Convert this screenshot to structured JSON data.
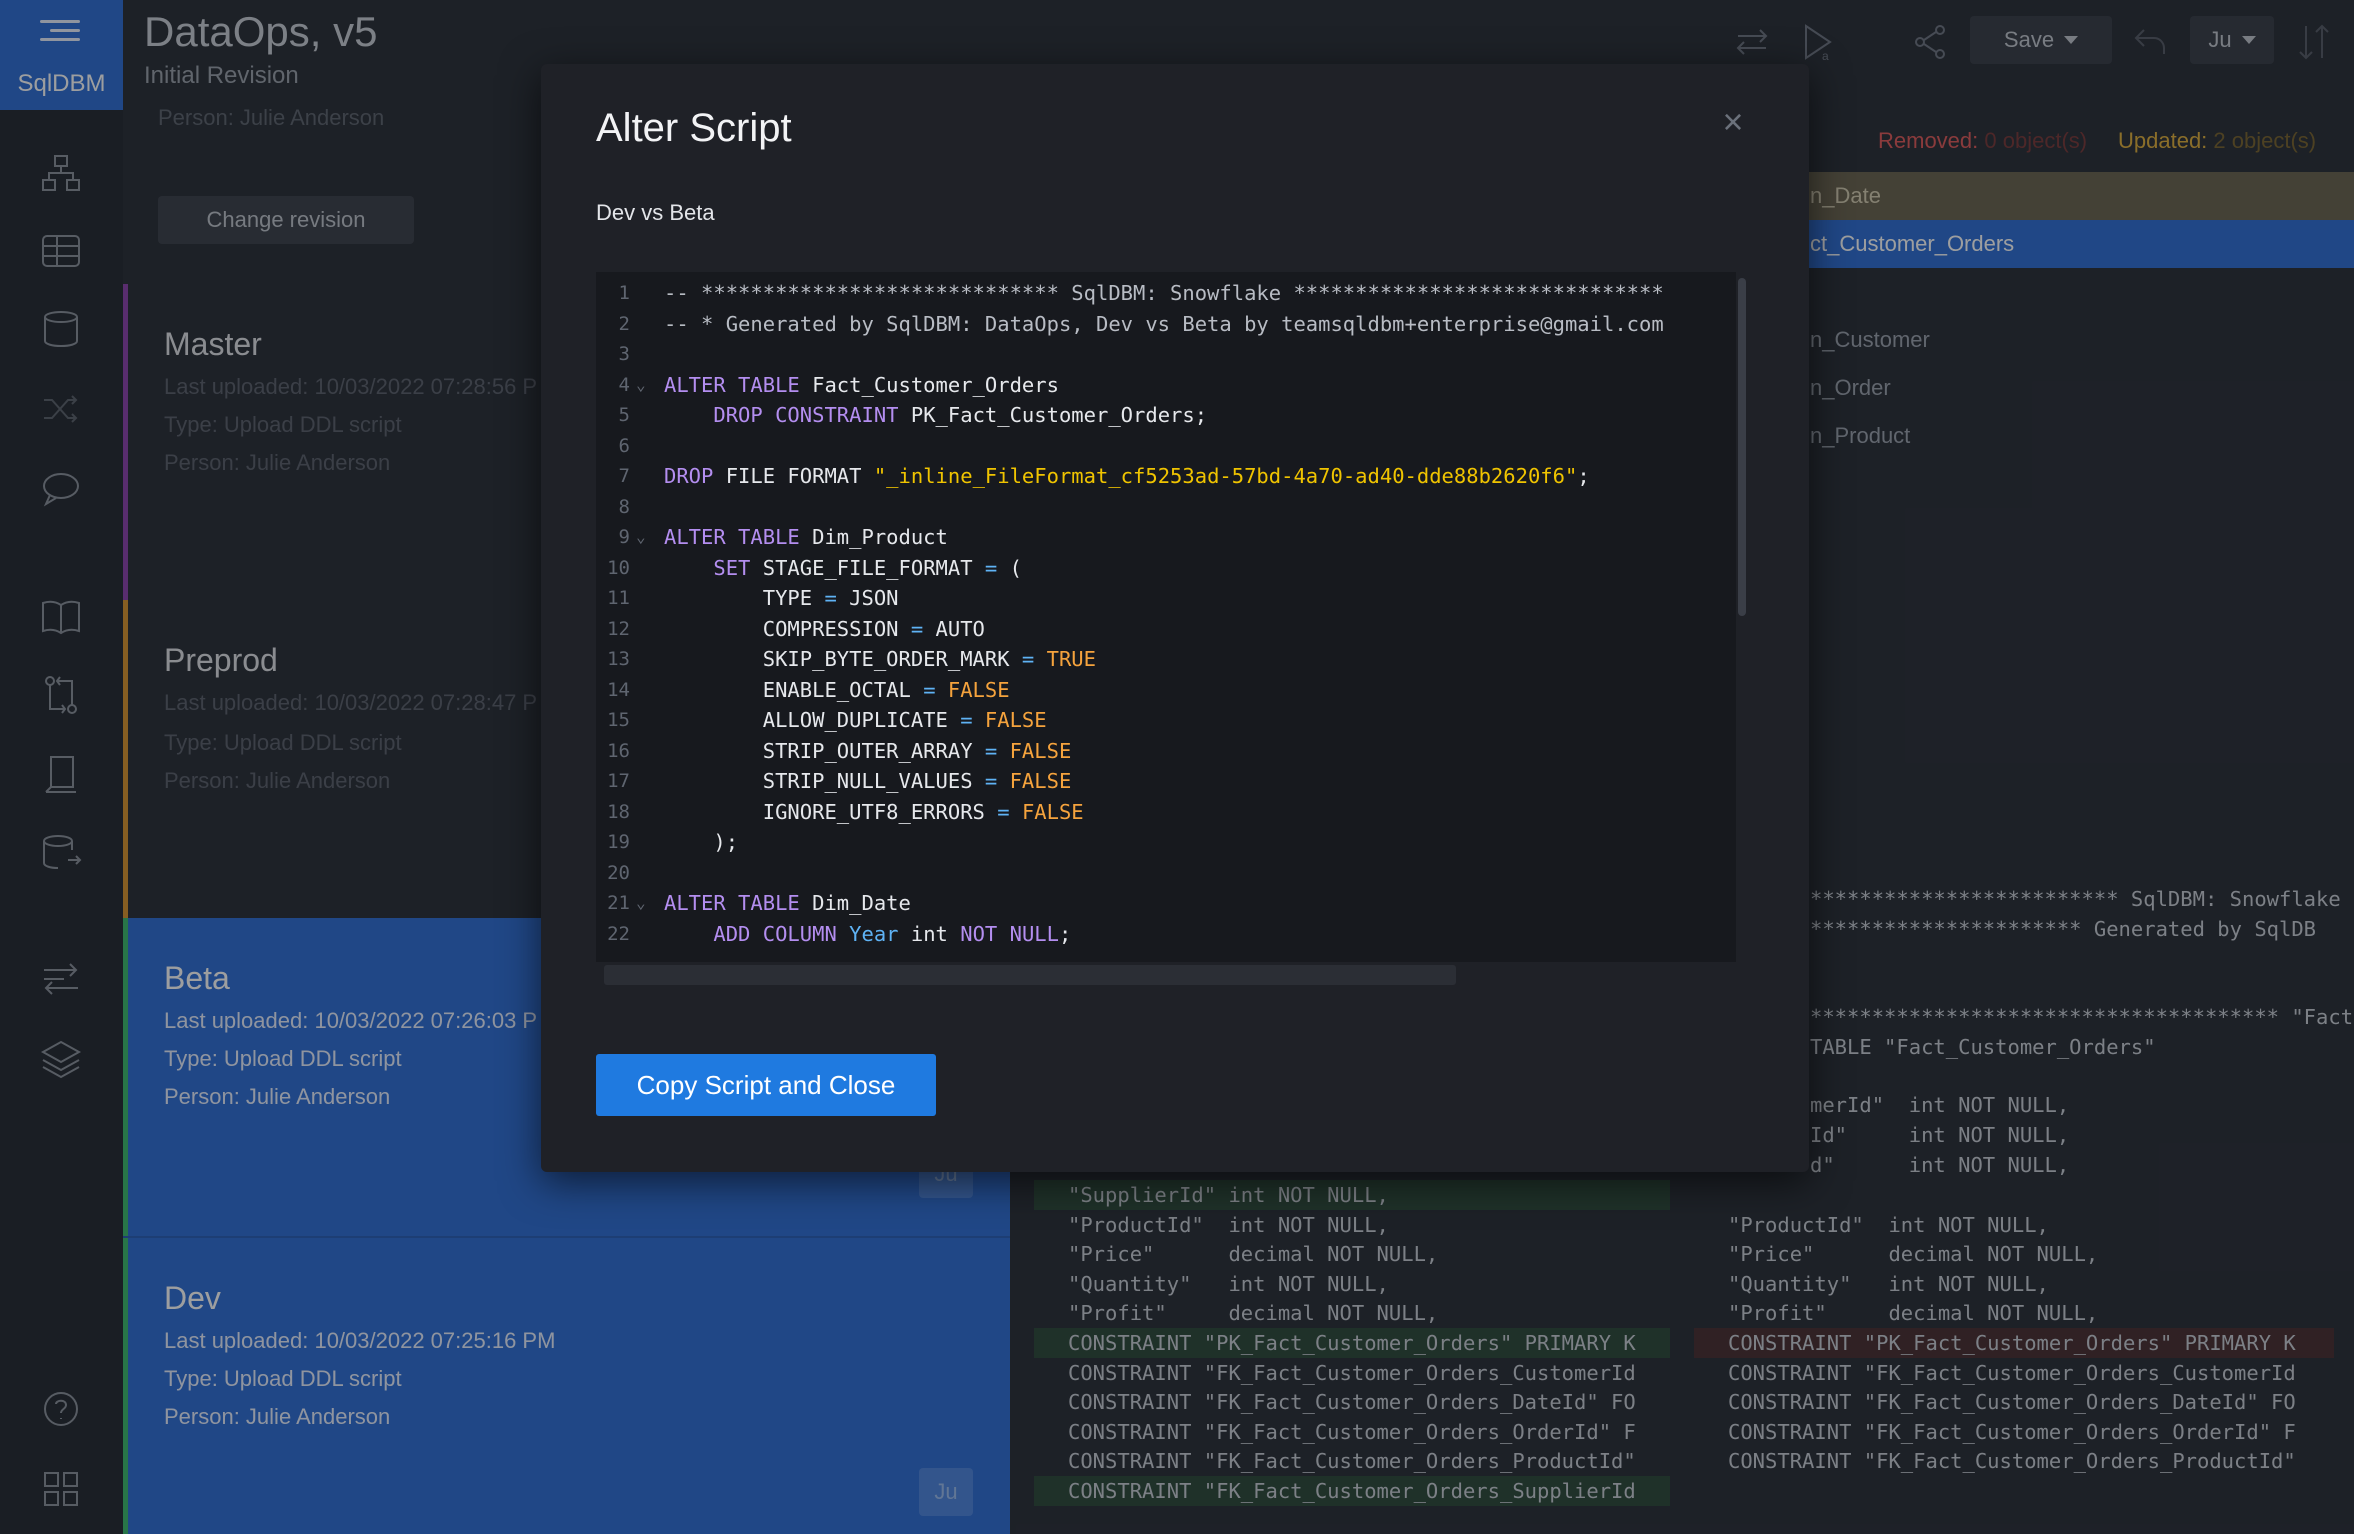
{
  "brand": {
    "name": "SqlDBM"
  },
  "header": {
    "title": "DataOps, v5",
    "subtitle": "Initial Revision",
    "save_label": "Save",
    "user_label": "Ju"
  },
  "revisions": {
    "top_person": "Person: Julie Anderson",
    "change_revision_label": "Change revision",
    "items": [
      {
        "name": "Master",
        "uploaded": "Last uploaded: 10/03/2022 07:28:56 P",
        "type": "Type: Upload DDL script",
        "person": "Person: Julie Anderson",
        "accent": "#9b59b6"
      },
      {
        "name": "Preprod",
        "uploaded": "Last uploaded: 10/03/2022 07:28:47 P",
        "type": "Type: Upload DDL script",
        "person": "Person: Julie Anderson",
        "accent": "#e6a23c"
      },
      {
        "name": "Beta",
        "uploaded": "Last uploaded: 10/03/2022 07:26:03 P",
        "type": "Type: Upload DDL script",
        "person": "Person: Julie Anderson",
        "accent": "#3dbb6e",
        "badge": "Ju"
      },
      {
        "name": "Dev",
        "uploaded": "Last uploaded: 10/03/2022 07:25:16 PM",
        "type": "Type: Upload DDL script",
        "person": "Person: Julie Anderson",
        "accent": "#3dbb6e",
        "badge": "Ju"
      }
    ]
  },
  "compare": {
    "removed_label": "Removed:",
    "removed_value": "0 object(s)",
    "updated_label": "Updated:",
    "updated_value": "2 object(s)",
    "objects": [
      "n_Date",
      "ct_Customer_Orders",
      "n_Customer",
      "n_Order",
      "n_Product"
    ],
    "right_code": [
      "************************* SqlDBM: Snowflake",
      "********************** Generated by SqlDB",
      "************************************** \"Fact",
      "TABLE \"Fact_Customer_Orders\"",
      "merId\"  int NOT NULL,",
      "Id\"     int NOT NULL,",
      "d\"      int NOT NULL,"
    ],
    "left_diff": [
      "\"SupplierId\" int NOT NULL,",
      "\"ProductId\"  int NOT NULL,",
      "\"Price\"      decimal NOT NULL,",
      "\"Quantity\"   int NOT NULL,",
      "\"Profit\"     decimal NOT NULL,",
      "CONSTRAINT \"PK_Fact_Customer_Orders\" PRIMARY K",
      "CONSTRAINT \"FK_Fact_Customer_Orders_CustomerId",
      "CONSTRAINT \"FK_Fact_Customer_Orders_DateId\" FO",
      "CONSTRAINT \"FK_Fact_Customer_Orders_OrderId\" F",
      "CONSTRAINT \"FK_Fact_Customer_Orders_ProductId\"",
      "CONSTRAINT \"FK_Fact_Customer_Orders_SupplierId"
    ],
    "right_diff": [
      "",
      "\"ProductId\"  int NOT NULL,",
      "\"Price\"      decimal NOT NULL,",
      "\"Quantity\"   int NOT NULL,",
      "\"Profit\"     decimal NOT NULL,",
      "CONSTRAINT \"PK_Fact_Customer_Orders\" PRIMARY K",
      "CONSTRAINT \"FK_Fact_Customer_Orders_CustomerId",
      "CONSTRAINT \"FK_Fact_Customer_Orders_DateId\" FO",
      "CONSTRAINT \"FK_Fact_Customer_Orders_OrderId\" F",
      "CONSTRAINT \"FK_Fact_Customer_Orders_ProductId\"",
      ""
    ]
  },
  "modal": {
    "title": "Alter Script",
    "close_glyph": "×",
    "subtitle": "Dev vs Beta",
    "copy_button_label": "Copy Script and Close",
    "lines": [
      {
        "n": "1",
        "tokens": [
          {
            "t": "-- ***************************** SqlDBM: Snowflake ******************************",
            "c": "cm"
          }
        ]
      },
      {
        "n": "2",
        "tokens": [
          {
            "t": "-- * Generated by SqlDBM: DataOps, Dev vs Beta by teamsqldbm+enterprise@gmail.com",
            "c": "cm"
          }
        ]
      },
      {
        "n": "3",
        "tokens": []
      },
      {
        "n": "4",
        "fold": true,
        "tokens": [
          {
            "t": "ALTER TABLE",
            "c": "kw"
          },
          {
            "t": " Fact_Customer_Orders"
          }
        ]
      },
      {
        "n": "5",
        "tokens": [
          {
            "t": "    "
          },
          {
            "t": "DROP CONSTRAINT",
            "c": "kw"
          },
          {
            "t": " PK_Fact_Customer_Orders;"
          }
        ]
      },
      {
        "n": "6",
        "tokens": []
      },
      {
        "n": "7",
        "tokens": [
          {
            "t": "DROP",
            "c": "kw"
          },
          {
            "t": " FILE FORMAT "
          },
          {
            "t": "\"_inline_FileFormat_cf5253ad-57bd-4a70-ad40-dde88b2620f6\"",
            "c": "str"
          },
          {
            "t": ";"
          }
        ]
      },
      {
        "n": "8",
        "tokens": []
      },
      {
        "n": "9",
        "fold": true,
        "tokens": [
          {
            "t": "ALTER TABLE",
            "c": "kw"
          },
          {
            "t": " Dim_Product"
          }
        ]
      },
      {
        "n": "10",
        "tokens": [
          {
            "t": "    "
          },
          {
            "t": "SET",
            "c": "kw"
          },
          {
            "t": " STAGE_FILE_FORMAT "
          },
          {
            "t": "=",
            "c": "op"
          },
          {
            "t": " ("
          }
        ]
      },
      {
        "n": "11",
        "tokens": [
          {
            "t": "        TYPE "
          },
          {
            "t": "=",
            "c": "op"
          },
          {
            "t": " JSON"
          }
        ]
      },
      {
        "n": "12",
        "tokens": [
          {
            "t": "        COMPRESSION "
          },
          {
            "t": "=",
            "c": "op"
          },
          {
            "t": " AUTO"
          }
        ]
      },
      {
        "n": "13",
        "tokens": [
          {
            "t": "        SKIP_BYTE_ORDER_MARK "
          },
          {
            "t": "=",
            "c": "op"
          },
          {
            "t": " "
          },
          {
            "t": "TRUE",
            "c": "bool"
          }
        ]
      },
      {
        "n": "14",
        "tokens": [
          {
            "t": "        ENABLE_OCTAL "
          },
          {
            "t": "=",
            "c": "op"
          },
          {
            "t": " "
          },
          {
            "t": "FALSE",
            "c": "bool"
          }
        ]
      },
      {
        "n": "15",
        "tokens": [
          {
            "t": "        ALLOW_DUPLICATE "
          },
          {
            "t": "=",
            "c": "op"
          },
          {
            "t": " "
          },
          {
            "t": "FALSE",
            "c": "bool"
          }
        ]
      },
      {
        "n": "16",
        "tokens": [
          {
            "t": "        STRIP_OUTER_ARRAY "
          },
          {
            "t": "=",
            "c": "op"
          },
          {
            "t": " "
          },
          {
            "t": "FALSE",
            "c": "bool"
          }
        ]
      },
      {
        "n": "17",
        "tokens": [
          {
            "t": "        STRIP_NULL_VALUES "
          },
          {
            "t": "=",
            "c": "op"
          },
          {
            "t": " "
          },
          {
            "t": "FALSE",
            "c": "bool"
          }
        ]
      },
      {
        "n": "18",
        "tokens": [
          {
            "t": "        IGNORE_UTF8_ERRORS "
          },
          {
            "t": "=",
            "c": "op"
          },
          {
            "t": " "
          },
          {
            "t": "FALSE",
            "c": "bool"
          }
        ]
      },
      {
        "n": "19",
        "tokens": [
          {
            "t": "    );"
          }
        ]
      },
      {
        "n": "20",
        "tokens": []
      },
      {
        "n": "21",
        "fold": true,
        "tokens": [
          {
            "t": "ALTER TABLE",
            "c": "kw"
          },
          {
            "t": " Dim_Date"
          }
        ]
      },
      {
        "n": "22",
        "tokens": [
          {
            "t": "    "
          },
          {
            "t": "ADD COLUMN",
            "c": "kw"
          },
          {
            "t": " "
          },
          {
            "t": "Year",
            "c": "op"
          },
          {
            "t": " int "
          },
          {
            "t": "NOT NULL",
            "c": "kw"
          },
          {
            "t": ";"
          }
        ]
      }
    ]
  },
  "colors": {
    "accent_blue": "#2f6fd6",
    "removed": "#e05a5a",
    "updated": "#e0b03c",
    "button": "#1f7ae0"
  },
  "icons": {
    "rail": [
      "diagram-icon",
      "table-icon",
      "database-icon",
      "shuffle-icon",
      "comment-icon",
      "book-icon",
      "compare-icon",
      "document-icon",
      "db-export-icon",
      "arrows-icon",
      "layers-icon",
      "help-icon",
      "apps-icon"
    ],
    "header": [
      "swap-icon",
      "run-icon",
      "share-icon",
      "undo-icon",
      "sort-icon"
    ]
  }
}
